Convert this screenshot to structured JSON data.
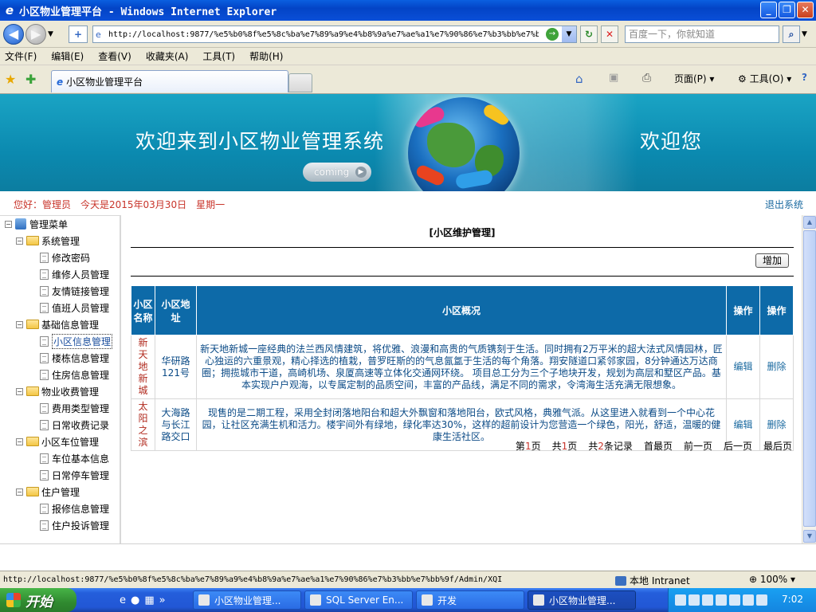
{
  "window": {
    "title": "小区物业管理平台 - Windows Internet Explorer",
    "buttons": {
      "minimize": "_",
      "maximize": "❐",
      "close": "✕"
    }
  },
  "address_bar": {
    "url": "http://localhost:9877/%e5%b0%8f%e5%8c%ba%e7%89%a9%e4%b8%9a%e7%ae%a1%e7%90%86%e7%b3%bb%e7%bb%9f/Admin/XQ",
    "search_placeholder": "百度一下，你就知道"
  },
  "menu": [
    "文件(F)",
    "编辑(E)",
    "查看(V)",
    "收藏夹(A)",
    "工具(T)",
    "帮助(H)"
  ],
  "tabs": {
    "active_label": "小区物业管理平台"
  },
  "command_bar": {
    "page": "页面(P)",
    "tools": "工具(O)",
    "help": "?"
  },
  "banner": {
    "welcome_text": "欢迎来到小区物业管理系统",
    "greeting": "欢迎您",
    "coming_label": "coming"
  },
  "info_line": {
    "user_text": "您好：管理员　今天是2015年03月30日　星期一",
    "logout": "退出系统"
  },
  "sidebar": {
    "root": "管理菜单",
    "groups": [
      {
        "label": "系统管理",
        "items": [
          "修改密码",
          "维修人员管理",
          "友情链接管理",
          "值班人员管理"
        ]
      },
      {
        "label": "基础信息管理",
        "items": [
          "小区信息管理",
          "楼栋信息管理",
          "住房信息管理"
        ]
      },
      {
        "label": "物业收费管理",
        "items": [
          "费用类型管理",
          "日常收费记录"
        ]
      },
      {
        "label": "小区车位管理",
        "items": [
          "车位基本信息",
          "日常停车管理"
        ]
      },
      {
        "label": "住户管理",
        "items": [
          "报修信息管理",
          "住户投诉管理"
        ]
      }
    ]
  },
  "main": {
    "page_header": "[小区维护管理]",
    "add_button": "增加",
    "columns": [
      "小区名称",
      "小区地址",
      "小区概况",
      "操作",
      "操作"
    ],
    "rows": [
      {
        "name": "新天地新城",
        "address": "华研路121号",
        "description": "新天地新城一座经典的法兰西风情建筑，将优雅、浪漫和高贵的气质镌刻于生活。同时拥有2万平米的超大法式风情园林，匠心独运的六重景观，精心择选的植栽，普罗旺斯的的气息氤氲于生活的每个角落。翔安隧道口紧邻家园，8分钟通达万达商圈；拥揽城市干道，高崎机场、泉厦高速等立体化交通网环绕。 项目总工分为三个子地块开发，规划为高层和墅区产品。基本实现户户观海，以专属定制的品质空间，丰富的产品线，满足不同的需求，令湾海生活充满无限想象。",
        "edit": "编辑",
        "delete": "删除"
      },
      {
        "name": "太阳之滨",
        "address": "大海路与长江路交口",
        "description": "现售的是二期工程，采用全封闭落地阳台和超大外飘窗和落地阳台，欧式风格，典雅气派。从这里进入就看到一个中心花园，让社区充满生机和活力。楼宇间外有绿地，绿化率达30%，这样的超前设计为您营造一个绿色，阳光，舒适，温暖的健康生活社区。",
        "edit": "编辑",
        "delete": "删除"
      }
    ],
    "pager": {
      "page_prefix": "第",
      "page_num": "1",
      "page_suffix": "页",
      "total_prefix": "共",
      "total_pages": "1",
      "total_suffix": "页",
      "records_prefix": "共",
      "records": "2",
      "records_suffix": "条记录",
      "first": "首最页",
      "prev": "前一页",
      "next": "后一页",
      "last": "最后页"
    }
  },
  "status_bar": {
    "url": "http://localhost:9877/%e5%b0%8f%e5%8c%ba%e7%89%a9%e4%b8%9a%e7%ae%a1%e7%90%86%e7%b3%bb%e7%bb%9f/Admin/XQI",
    "zone": "本地 Intranet",
    "zoom": "100%"
  },
  "taskbar": {
    "start": "开始",
    "buttons": [
      "小区物业管理...",
      "SQL Server En...",
      "开发",
      "小区物业管理..."
    ],
    "clock": "7:02"
  }
}
